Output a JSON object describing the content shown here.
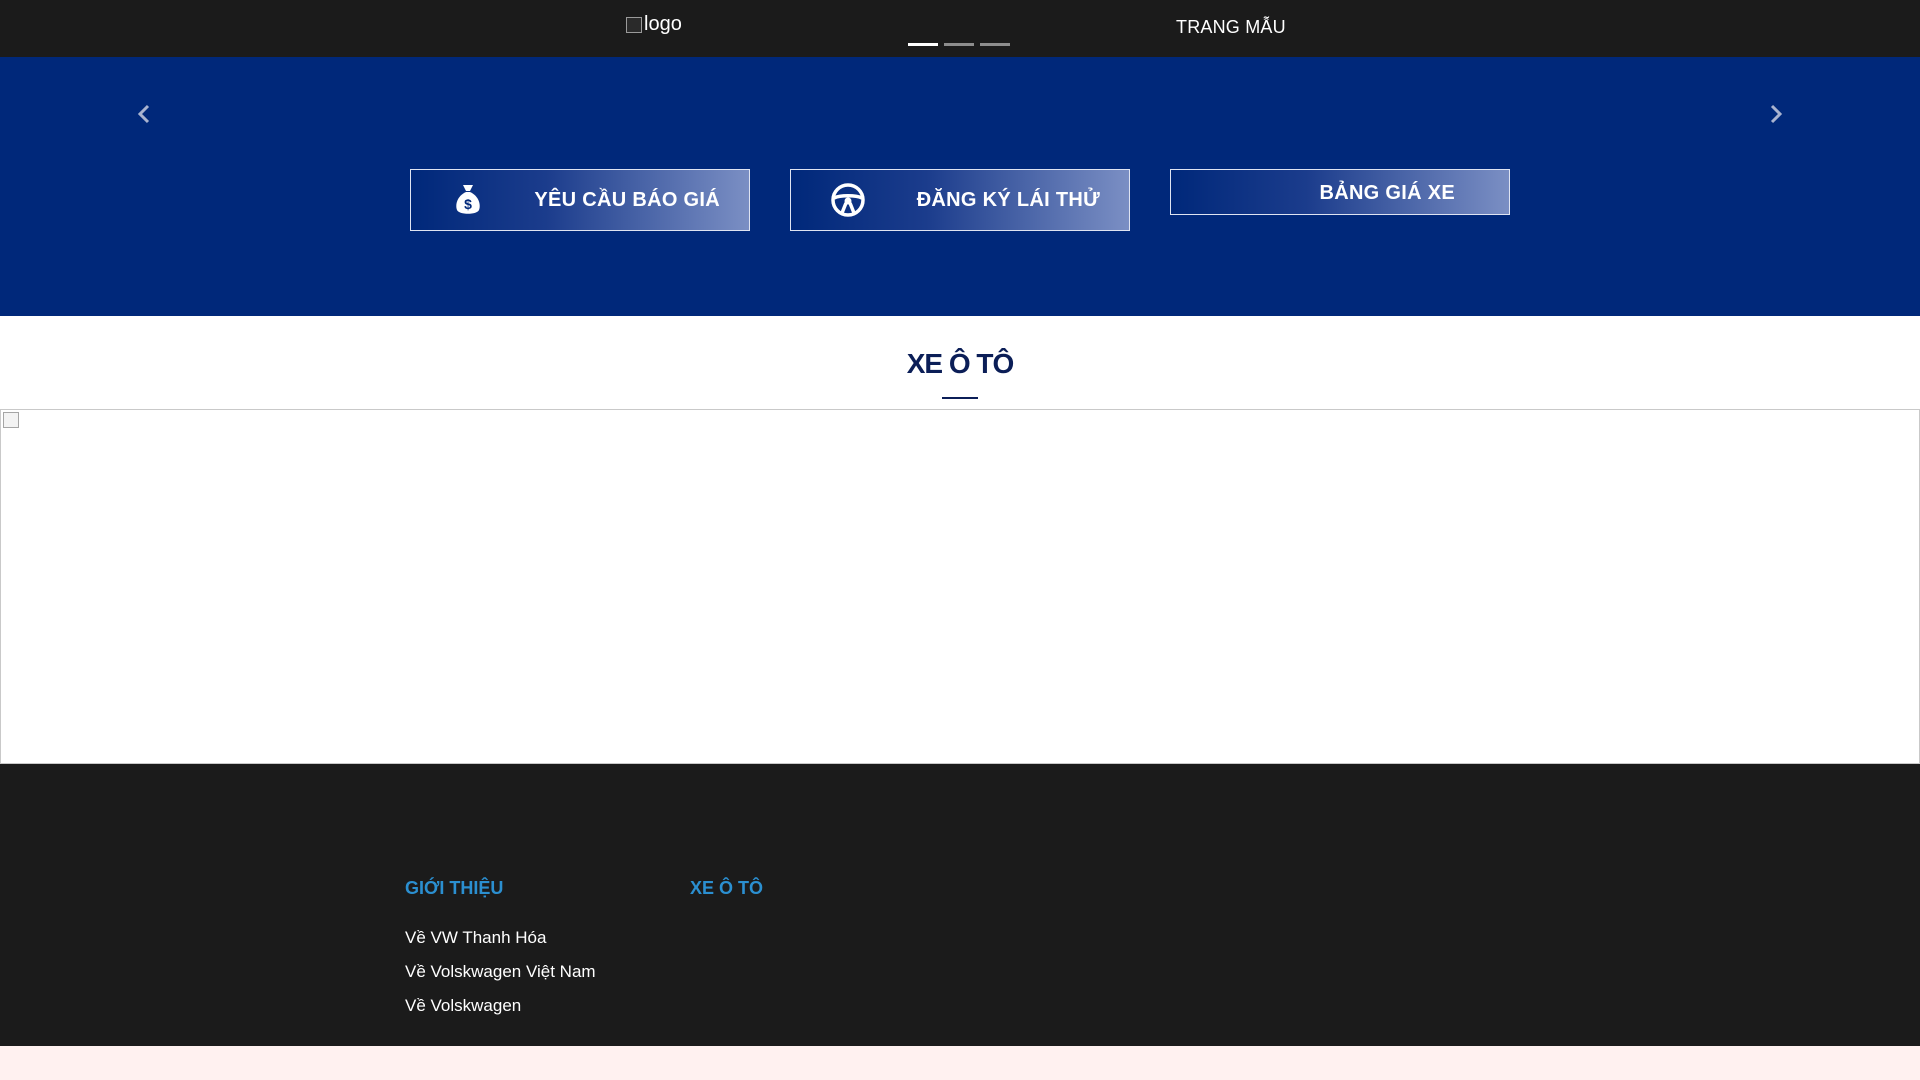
{
  "header": {
    "logo_alt": "logo",
    "title": "TRANG MẪU"
  },
  "carousel": {
    "indicator_count": 3,
    "active_index": 0,
    "prev_label": "Previous",
    "next_label": "Next"
  },
  "cta_buttons": [
    {
      "label": "YÊU CẦU BÁO GIÁ",
      "icon": "money-bag-icon"
    },
    {
      "label": "ĐĂNG KÝ LÁI THỬ",
      "icon": "steering-wheel-icon"
    },
    {
      "label": "BẢNG GIÁ XE",
      "icon": ""
    }
  ],
  "main": {
    "section_title": "XE Ô TÔ"
  },
  "footer": {
    "columns": [
      {
        "heading": "GIỚI THIỆU",
        "links": [
          "Về VW Thanh Hóa",
          "Về Volskwagen Việt Nam",
          "Về Volskwagen"
        ]
      },
      {
        "heading": "XE Ô TÔ",
        "links": []
      }
    ]
  },
  "colors": {
    "topbar": "#1b1b1b",
    "hero": "#00287a",
    "title": "#0b1e57",
    "footer_heading": "#2b8fd0",
    "bottom_strip": "#fff1f0"
  }
}
